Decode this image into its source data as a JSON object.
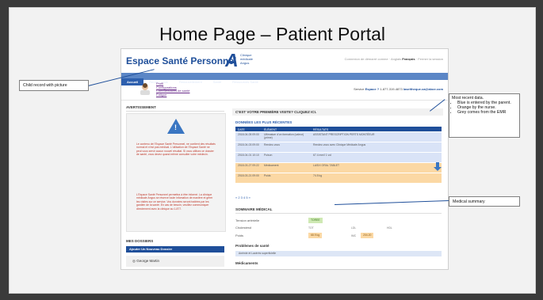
{
  "slide_title": "Home Page – Patient Portal",
  "portal": {
    "brand": "Espace Santé Personnel",
    "logo_letter": "A",
    "logo_sub": "Clinique médicale Angus",
    "top_links": {
      "prefix": "Connexion de démarré comme",
      "sep": "Anglais",
      "active_lang": "Français",
      "logout": "Fermer la session"
    },
    "tabs": [
      "Accueil",
      "Rendez-vous",
      "Renouvellement",
      "Santé",
      "Ressources Santé"
    ],
    "child_links": [
      "Profil",
      "Configurations",
      "Commentaires de santé",
      "Fatigue"
    ],
    "right_info": {
      "label": "Service ",
      "link": "Espace ?",
      "rest": " 1-877-319-4873  ",
      "email": "laseltheque.ca@aboe.com"
    }
  },
  "warning": {
    "heading": "AVERTISSEMENT",
    "icon_mark": "!",
    "text1": "Le contenu de l'Espace Santé Personnel, ne contient des résultats normal et n'est pas médical. L'utilisation de l'Espace Santé ne peut vous servir aucun nouvel résultat. Si vous utilisez ce dossier de santé, vous devez quand même consulter votre médecin.",
    "text2": "L'Espace Santé Personnel permettra à être informé. La clinique médicale Angus se réserve toute infomation de manière et gérer les visites sur ce service. Vos données seront traitées par les gardien de la santé. En cas de besoin, veuillez communiquer directement avec la clinique au 1-877."
  },
  "dossiers": {
    "heading": "MES DOSSIERS",
    "add_button": "Ajouter Un Nouveau Dossier",
    "person": "George Martin"
  },
  "main": {
    "first_visit_banner": "C'EST VOTRE PREMIÈRE VISITE? CLIQUEZ ICI.",
    "recent_heading": "DONNÉES LES PLUS RÉCENTES",
    "table_headers": [
      "DATE",
      "ÉLÉMENT",
      "RÉSULTATS"
    ],
    "rows": [
      {
        "date": "2018-04-05 09:00",
        "element": "Ultimatum d'un formation (valeur) (prime)",
        "result": "ASSISTANT PRESCRIPTION PERTS MONTÉEUR",
        "color": "blue"
      },
      {
        "date": "2018-04-03 09:00",
        "element": "Rendez-vous",
        "result": "Rendez-vous avec Clinique Médicale Angus",
        "color": "blue"
      },
      {
        "date": "2018-04-01 10:10",
        "element": "Poison",
        "result": "67.4 mm/l 1 vol",
        "color": "blue"
      },
      {
        "date": "2018-03-27 09:22",
        "element": "Médicament",
        "result": "LASIX ORAL TABLET",
        "color": "orange"
      },
      {
        "date": "2018-03-21 09:00",
        "element": "Poids",
        "result": "74.5 kg",
        "color": "orange"
      }
    ],
    "pager": "« 2 3 4 5 »",
    "medical_heading": "SOMMAIRE MÉDICAL",
    "medical": {
      "bp_label": "Tension artérielle",
      "bp_value": "TOREE",
      "chol_label": "Cholestérol",
      "chol_a": "TOT",
      "chol_b": "LDL",
      "chol_c": "HDL",
      "weight_label": "Poids",
      "weight_value": "68.9 kg",
      "imc_label": "IMC",
      "imc_value": "204.20"
    },
    "problems_heading": "Problèmes de santé",
    "problems_item": "Anémie et Lacérés superficielle",
    "meds_heading": "Médicaments"
  },
  "callouts": {
    "child_record": "Child record with picture",
    "recent_title": "Most recent data.",
    "recent_bullets": [
      "Blue is entered by the parent.",
      "Orange by the nurse.",
      "Grey comes from the EMR"
    ],
    "medical_summary": "Medical summary"
  },
  "colors": {
    "brand": "#1f4f9a",
    "nav": "#5b86c6",
    "entry_parent": "#d9e3f7",
    "entry_nurse": "#fbd8a4"
  }
}
